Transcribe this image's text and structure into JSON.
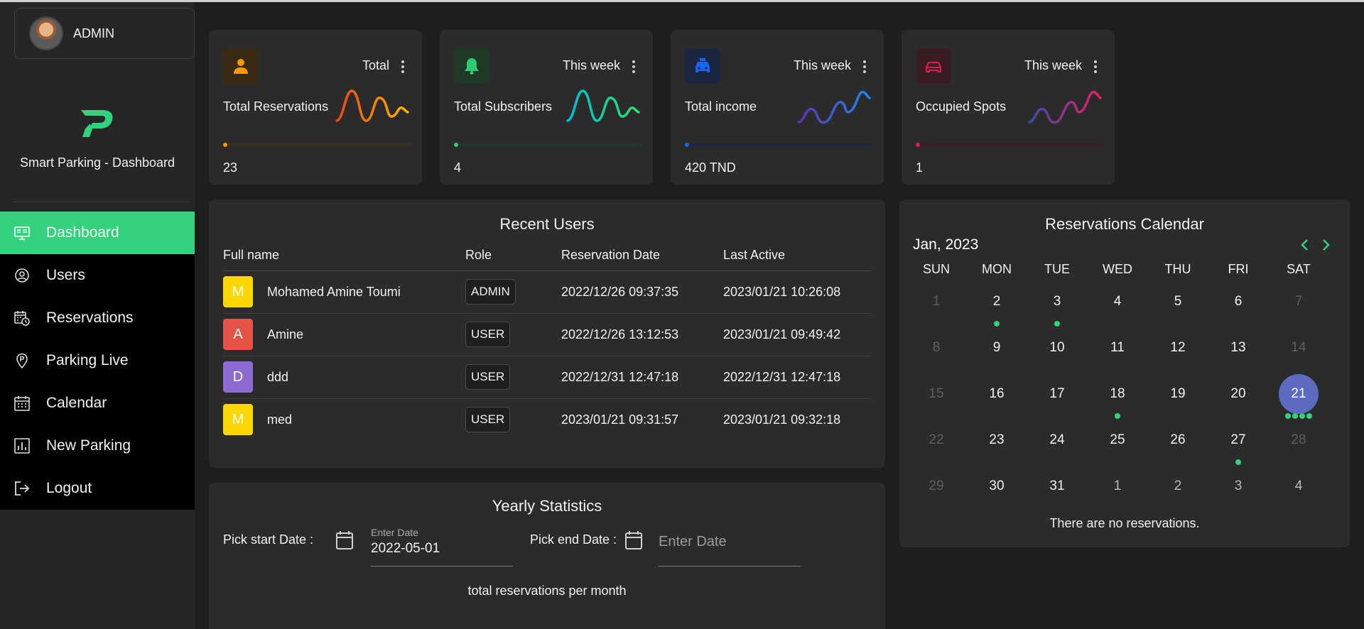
{
  "sidebar": {
    "admin_name": "ADMIN",
    "brand": "Smart Parking - Dashboard",
    "items": [
      {
        "label": "Dashboard",
        "icon": "monitor-icon"
      },
      {
        "label": "Users",
        "icon": "user-icon"
      },
      {
        "label": "Reservations",
        "icon": "calendar-clock-icon"
      },
      {
        "label": "Parking Live",
        "icon": "location-pin-icon"
      },
      {
        "label": "Calendar",
        "icon": "calendar-icon"
      },
      {
        "label": "New Parking",
        "icon": "chart-icon"
      },
      {
        "label": "Logout",
        "icon": "logout-icon"
      }
    ],
    "accent": "#34d17f"
  },
  "stats": [
    {
      "period": "Total",
      "title": "Total Reservations",
      "value": "23",
      "icon": "person-icon",
      "color": "#ff9800",
      "spark": [
        "#e64a19",
        "#ffb300"
      ]
    },
    {
      "period": "This week",
      "title": "Total Subscribers",
      "value": "4",
      "icon": "bell-icon",
      "color": "#2ecc71",
      "spark": [
        "#00bcd4",
        "#2ee06a"
      ]
    },
    {
      "period": "This week",
      "title": "Total income",
      "value": "420 TND",
      "icon": "taxi-icon",
      "color": "#1565ff",
      "spark": [
        "#5e35b1",
        "#1e88e5"
      ]
    },
    {
      "period": "This week",
      "title": "Occupied Spots",
      "value": "1",
      "icon": "car-icon",
      "color": "#e0194f",
      "spark": [
        "#3949ab",
        "#e91e63"
      ]
    }
  ],
  "recent_users": {
    "title": "Recent Users",
    "headers": [
      "Full name",
      "Role",
      "Reservation Date",
      "Last Active"
    ],
    "rows": [
      {
        "initial": "M",
        "name": "Mohamed Amine Toumi",
        "role": "ADMIN",
        "reservation": "2022/12/26 09:37:35",
        "last_active": "2023/01/21 10:26:08",
        "color": "#ffd600"
      },
      {
        "initial": "A",
        "name": "Amine",
        "role": "USER",
        "reservation": "2022/12/26 13:12:53",
        "last_active": "2023/01/21 09:49:42",
        "color": "#e55347"
      },
      {
        "initial": "D",
        "name": "ddd",
        "role": "USER",
        "reservation": "2022/12/31 12:47:18",
        "last_active": "2022/12/31 12:47:18",
        "color": "#8d6ad2"
      },
      {
        "initial": "M",
        "name": "med",
        "role": "USER",
        "reservation": "2023/01/21 09:31:57",
        "last_active": "2023/01/21 09:32:18",
        "color": "#ffd600"
      }
    ]
  },
  "yearly": {
    "title": "Yearly Statistics",
    "start_label": "Pick start Date :",
    "start_small": "Enter Date",
    "start_value": "2022-05-01",
    "end_label": "Pick end Date :",
    "end_placeholder": "Enter Date",
    "subtitle": "total reservations per month"
  },
  "calendar": {
    "title": "Reservations Calendar",
    "month": "Jan, 2023",
    "weekdays": [
      "SUN",
      "MON",
      "TUE",
      "WED",
      "THU",
      "FRI",
      "SAT"
    ],
    "weeks": [
      [
        {
          "d": "1",
          "dim": true
        },
        {
          "d": "2",
          "dots": 1
        },
        {
          "d": "3",
          "dots": 1
        },
        {
          "d": "4"
        },
        {
          "d": "5"
        },
        {
          "d": "6"
        },
        {
          "d": "7",
          "dim": true
        }
      ],
      [
        {
          "d": "8",
          "dim": true
        },
        {
          "d": "9"
        },
        {
          "d": "10"
        },
        {
          "d": "11"
        },
        {
          "d": "12"
        },
        {
          "d": "13"
        },
        {
          "d": "14",
          "dim": true
        }
      ],
      [
        {
          "d": "15",
          "dim": true
        },
        {
          "d": "16"
        },
        {
          "d": "17"
        },
        {
          "d": "18",
          "dots": 1
        },
        {
          "d": "19"
        },
        {
          "d": "20"
        },
        {
          "d": "21",
          "sel": true,
          "dots": 4
        }
      ],
      [
        {
          "d": "22",
          "dim": true
        },
        {
          "d": "23"
        },
        {
          "d": "24"
        },
        {
          "d": "25"
        },
        {
          "d": "26"
        },
        {
          "d": "27",
          "dots": 1
        },
        {
          "d": "28",
          "dim": true
        }
      ],
      [
        {
          "d": "29",
          "dim": true
        },
        {
          "d": "30"
        },
        {
          "d": "31"
        },
        {
          "d": "1",
          "out": true
        },
        {
          "d": "2",
          "out": true
        },
        {
          "d": "3",
          "out": true
        },
        {
          "d": "4",
          "out": true
        }
      ]
    ],
    "empty_message": "There are no reservations.",
    "selected_color": "#5c6bc0"
  }
}
